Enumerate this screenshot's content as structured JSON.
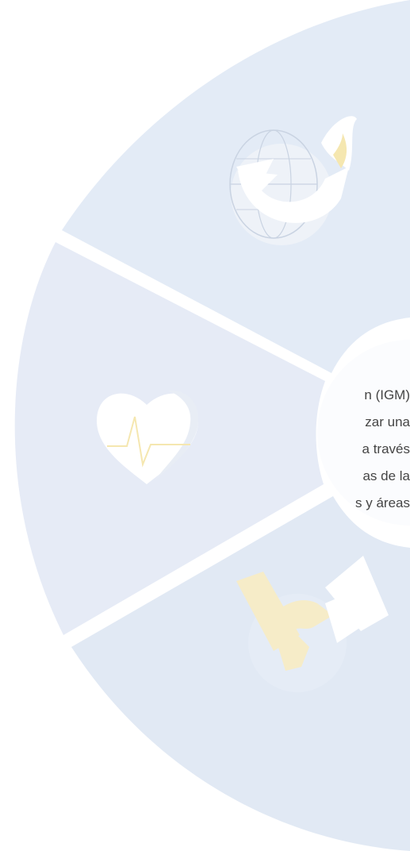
{
  "intro": {
    "lines": [
      "n (IGM)",
      "zar una",
      "a través",
      "as de la",
      "s y áreas"
    ]
  },
  "segments": [
    {
      "name": "global-mission",
      "icon": "globe-dove-icon"
    },
    {
      "name": "health",
      "icon": "heart-pulse-icon"
    },
    {
      "name": "partnership",
      "icon": "handshake-icon"
    }
  ],
  "colors": {
    "segment_fill": "#e2eaf5",
    "segment_fill_mid": "#e6ebf6",
    "center_fill": "#fafbfe",
    "icon_white": "#ffffff",
    "icon_accent": "#f5e7b0",
    "icon_line": "#c9d3e2",
    "text": "#454545"
  }
}
